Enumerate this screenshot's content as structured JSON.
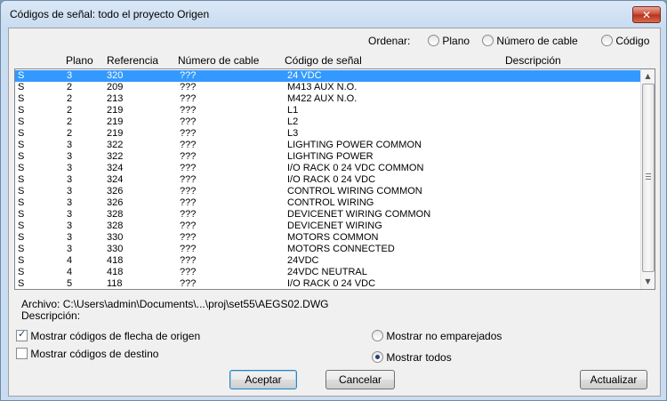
{
  "window": {
    "title": "Códigos de señal: todo el proyecto Origen"
  },
  "sort": {
    "label": "Ordenar:",
    "options": [
      {
        "label": "Plano",
        "selected": false
      },
      {
        "label": "Número de cable",
        "selected": false
      },
      {
        "label": "Código",
        "selected": false
      }
    ]
  },
  "columns": [
    "Plano",
    "Referencia",
    "Número de cable",
    "Código de señal",
    "Descripción"
  ],
  "rows": [
    [
      "S",
      "3",
      "320",
      "???",
      "24 VDC"
    ],
    [
      "S",
      "2",
      "209",
      "???",
      "M413 AUX N.O."
    ],
    [
      "S",
      "2",
      "213",
      "???",
      "M422 AUX N.O."
    ],
    [
      "S",
      "2",
      "219",
      "???",
      "L1"
    ],
    [
      "S",
      "2",
      "219",
      "???",
      "L2"
    ],
    [
      "S",
      "2",
      "219",
      "???",
      "L3"
    ],
    [
      "S",
      "3",
      "322",
      "???",
      "LIGHTING POWER COMMON"
    ],
    [
      "S",
      "3",
      "322",
      "???",
      "LIGHTING POWER"
    ],
    [
      "S",
      "3",
      "324",
      "???",
      "I/O RACK 0 24 VDC COMMON"
    ],
    [
      "S",
      "3",
      "324",
      "???",
      "I/O RACK 0 24 VDC"
    ],
    [
      "S",
      "3",
      "326",
      "???",
      "CONTROL WIRING COMMON"
    ],
    [
      "S",
      "3",
      "326",
      "???",
      "CONTROL WIRING"
    ],
    [
      "S",
      "3",
      "328",
      "???",
      "DEVICENET WIRING COMMON"
    ],
    [
      "S",
      "3",
      "328",
      "???",
      "DEVICENET WIRING"
    ],
    [
      "S",
      "3",
      "330",
      "???",
      "MOTORS COMMON"
    ],
    [
      "S",
      "3",
      "330",
      "???",
      "MOTORS CONNECTED"
    ],
    [
      "S",
      "4",
      "418",
      "???",
      "24VDC"
    ],
    [
      "S",
      "4",
      "418",
      "???",
      "24VDC NEUTRAL"
    ],
    [
      "S",
      "5",
      "118",
      "???",
      "I/O RACK 0 24 VDC"
    ]
  ],
  "selected_row": 0,
  "info": {
    "file_label": "Archivo:",
    "file_value": "C:\\Users\\admin\\Documents\\...\\proj\\set55\\AEGS02.DWG",
    "desc_label": "Descripción:"
  },
  "options": {
    "show_source_arrow": {
      "label": "Mostrar códigos de flecha de origen",
      "checked": true
    },
    "show_destination": {
      "label": "Mostrar códigos de destino",
      "checked": false
    },
    "show_unmatched": {
      "label": "Mostrar no emparejados",
      "selected": false
    },
    "show_all": {
      "label": "Mostrar todos",
      "selected": true
    }
  },
  "buttons": {
    "accept": "Aceptar",
    "cancel": "Cancelar",
    "refresh": "Actualizar"
  },
  "colors": {
    "selection": "#3399ff"
  }
}
